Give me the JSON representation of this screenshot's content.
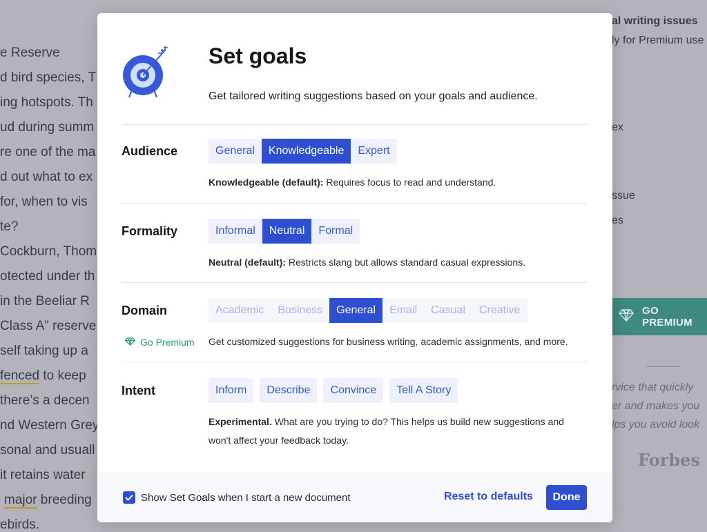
{
  "background": {
    "doc_lines": [
      "e Reserve",
      "d bird species, T",
      "ing hotspots. Th",
      "ud during summ",
      "re one of the ma",
      "d out what to ex",
      " for, when to vis",
      "te?",
      "Cockburn, Thom",
      "otected under th",
      " in the Beeliar R",
      "Class A” reserve",
      "self taking up a",
      "fenced",
      " to keep",
      " there’s a decen",
      "nd Western Grey",
      "sonal and usuall",
      "it retains water",
      "major",
      " breeding",
      "ebirds."
    ],
    "right_panel": {
      "title": "al writing issues",
      "subtitle": "ly for Premium use",
      "item_1": "ex",
      "item_2": "ssue",
      "item_3": "es",
      "premium_label": "GO PREMIUM",
      "quote_1": "rvice that quickly",
      "quote_2": "er and makes you",
      "quote_3": "lps you avoid look",
      "quote_source": "Forbes"
    }
  },
  "modal": {
    "title": "Set goals",
    "subtitle": "Get tailored writing suggestions based on your goals and audience.",
    "audience": {
      "label": "Audience",
      "options": [
        "General",
        "Knowledgeable",
        "Expert"
      ],
      "selected": "Knowledgeable",
      "desc_bold": "Knowledgeable (default):",
      "desc_text": " Requires focus to read and understand."
    },
    "formality": {
      "label": "Formality",
      "options": [
        "Informal",
        "Neutral",
        "Formal"
      ],
      "selected": "Neutral",
      "desc_bold": "Neutral (default):",
      "desc_text": " Restricts slang but allows standard casual expressions."
    },
    "domain": {
      "label": "Domain",
      "options": [
        "Academic",
        "Business",
        "General",
        "Email",
        "Casual",
        "Creative"
      ],
      "selected": "General",
      "go_premium": "Go Premium",
      "desc_text": "Get customized suggestions for business writing, academic assignments, and more."
    },
    "intent": {
      "label": "Intent",
      "options": [
        "Inform",
        "Describe",
        "Convince",
        "Tell A Story"
      ],
      "desc_bold": "Experimental.",
      "desc_text_1": " What are you trying to do? This helps us build new suggestions and",
      "desc_text_2": "won't affect your feedback today."
    },
    "footer": {
      "checkbox_checked": true,
      "check_prefix": "Show ",
      "check_bold": "Set Goals",
      "check_suffix": " when I start a new document",
      "reset_label": "Reset to defaults",
      "done_label": "Done"
    }
  },
  "colors": {
    "accent": "#2f4fd1",
    "premium_green": "#25996f",
    "teal_button": "#3e8a80"
  }
}
